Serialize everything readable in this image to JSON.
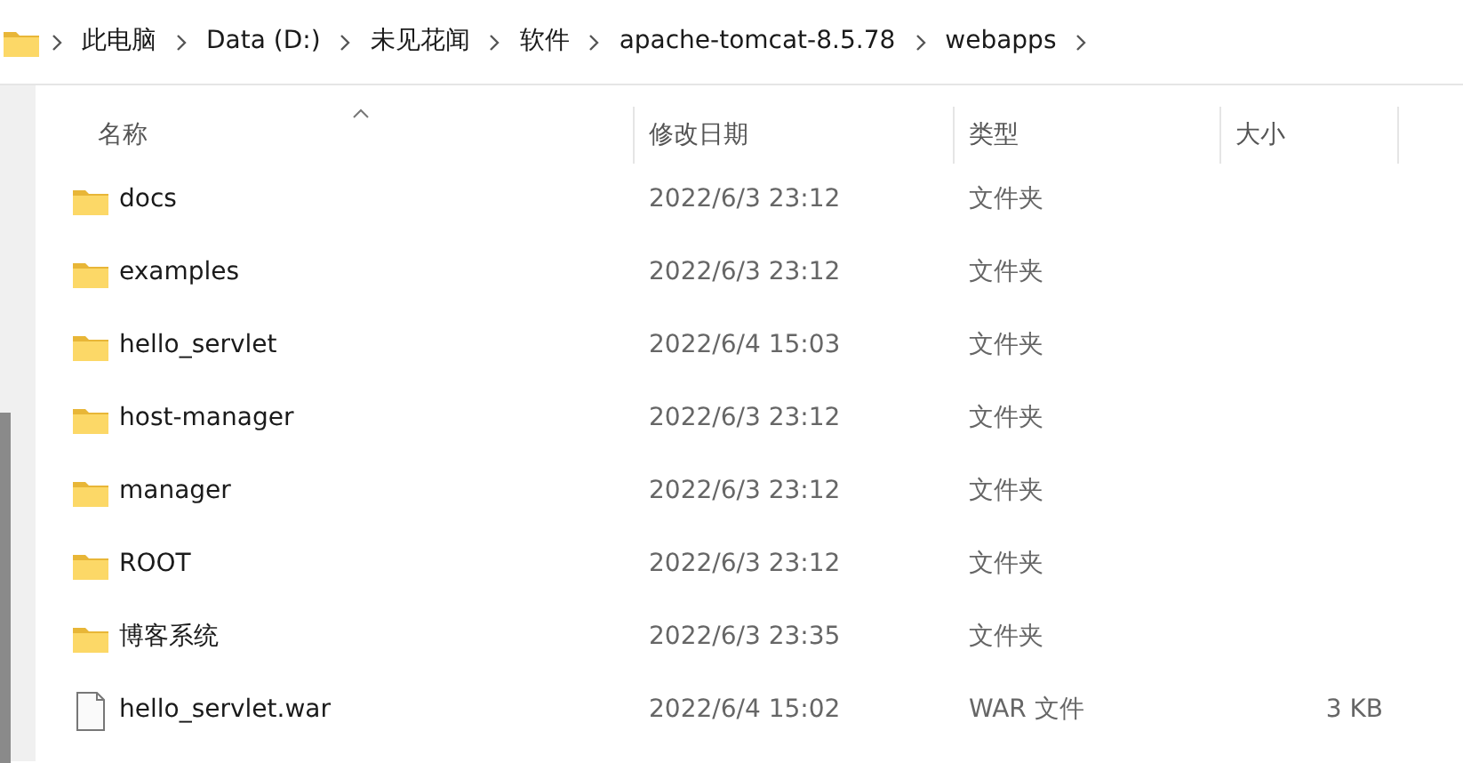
{
  "breadcrumb": [
    "此电脑",
    "Data (D:)",
    "未见花闻",
    "软件",
    "apache-tomcat-8.5.78",
    "webapps"
  ],
  "columns": [
    {
      "label": "名称",
      "sorted": true
    },
    {
      "label": "修改日期",
      "sorted": false
    },
    {
      "label": "类型",
      "sorted": false
    },
    {
      "label": "大小",
      "sorted": false
    }
  ],
  "rows": [
    {
      "kind": "folder",
      "name": "docs",
      "modified": "2022/6/3 23:12",
      "type": "文件夹"
    },
    {
      "kind": "folder",
      "name": "examples",
      "modified": "2022/6/3 23:12",
      "type": "文件夹"
    },
    {
      "kind": "folder",
      "name": "hello_servlet",
      "modified": "2022/6/4 15:03",
      "type": "文件夹"
    },
    {
      "kind": "folder",
      "name": "host-manager",
      "modified": "2022/6/3 23:12",
      "type": "文件夹"
    },
    {
      "kind": "folder",
      "name": "manager",
      "modified": "2022/6/3 23:12",
      "type": "文件夹"
    },
    {
      "kind": "folder",
      "name": "ROOT",
      "modified": "2022/6/3 23:12",
      "type": "文件夹"
    },
    {
      "kind": "folder",
      "name": "博客系统",
      "modified": "2022/6/3 23:35",
      "type": "文件夹"
    },
    {
      "kind": "file",
      "name": "hello_servlet.war",
      "modified": "2022/6/4 15:02",
      "type": "WAR 文件",
      "size": "3 KB"
    }
  ]
}
